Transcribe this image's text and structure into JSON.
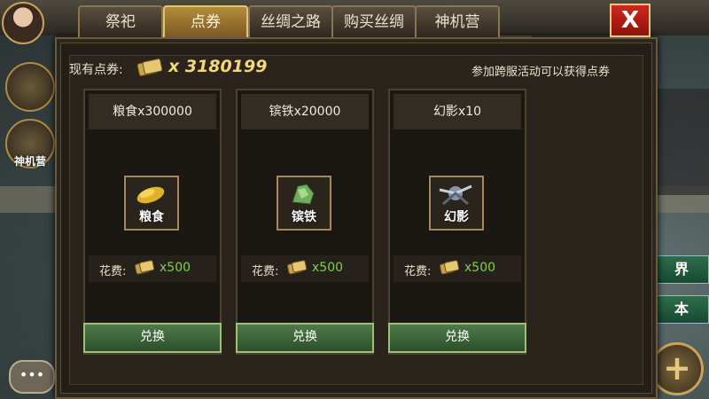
{
  "tabs": [
    {
      "label": "祭祀",
      "active": false
    },
    {
      "label": "点券",
      "active": true
    },
    {
      "label": "丝绸之路",
      "active": false
    },
    {
      "label": "购买丝绸",
      "active": false
    },
    {
      "label": "神机营",
      "active": false
    }
  ],
  "close_label": "X",
  "coupon": {
    "label": "现有点券:",
    "value": "x 3180199"
  },
  "hint": "参加跨服活动可以获得点券",
  "cost_label": "花费:",
  "exchange_label": "兑换",
  "items": [
    {
      "title": "粮食x300000",
      "name": "粮食",
      "cost": "x500",
      "icon": "grain-icon"
    },
    {
      "title": "镔铁x20000",
      "name": "镔铁",
      "cost": "x500",
      "icon": "iron-ore-icon"
    },
    {
      "title": "幻影x10",
      "name": "幻影",
      "cost": "x500",
      "icon": "phantom-icon"
    }
  ],
  "left_button": "神机营",
  "side_tags": [
    "界",
    "本"
  ],
  "colors": {
    "accent_gold": "#f4d77a",
    "cost_green": "#7fd24c",
    "close_red": "#d0271e",
    "button_green": "#4f7a4a"
  }
}
